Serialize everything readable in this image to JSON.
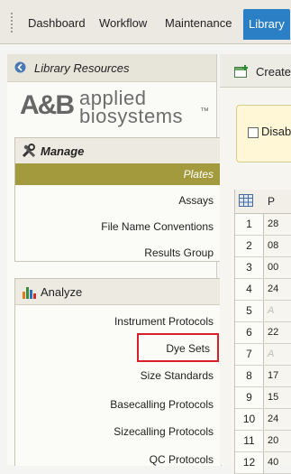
{
  "nav": {
    "tabs": [
      "Dashboard",
      "Workflow",
      "Maintenance",
      "Library"
    ],
    "active": "Library"
  },
  "left_panel": {
    "title": "Library Resources",
    "logo": {
      "mark": "A&B",
      "line1": "applied",
      "line2": "biosystems",
      "trademark": "™"
    },
    "manage": {
      "title": "Manage",
      "items": [
        "Plates",
        "Assays",
        "File Name Conventions",
        "Results Group"
      ],
      "selected": "Plates"
    },
    "analyze": {
      "title": "Analyze",
      "items": [
        "Instrument Protocols",
        "Dye Sets",
        "Size Standards",
        "Basecalling Protocols",
        "Sizecalling Protocols",
        "QC Protocols"
      ],
      "highlighted": "Dye Sets"
    }
  },
  "right_panel": {
    "create_label": "Create",
    "filter_label": "Disab",
    "column_header": "P",
    "rows": [
      {
        "num": "1",
        "cell": "28"
      },
      {
        "num": "2",
        "cell": "08"
      },
      {
        "num": "3",
        "cell": "00"
      },
      {
        "num": "4",
        "cell": "24"
      },
      {
        "num": "5",
        "cell": "A"
      },
      {
        "num": "6",
        "cell": "22"
      },
      {
        "num": "7",
        "cell": "A"
      },
      {
        "num": "8",
        "cell": "17"
      },
      {
        "num": "9",
        "cell": "15"
      },
      {
        "num": "10",
        "cell": "24"
      },
      {
        "num": "11",
        "cell": "20"
      },
      {
        "num": "12",
        "cell": "40"
      }
    ]
  },
  "colors": {
    "active_tab": "#2a7fc5",
    "selected_item": "#a39a3e",
    "highlight_box": "#d6202a",
    "filter_bg": "#fff7d6"
  }
}
